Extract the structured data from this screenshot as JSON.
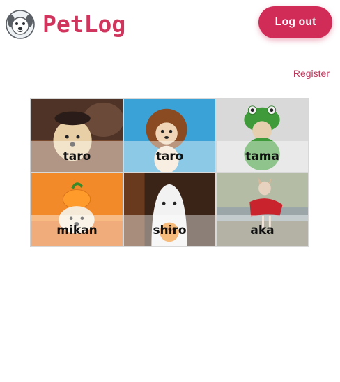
{
  "header": {
    "brand": "PetLog",
    "logo_icon": "dog-face-icon",
    "logout_label": "Log out"
  },
  "nav": {
    "register_label": "Register"
  },
  "pets": [
    {
      "name": "taro",
      "photo": "dog-in-pirate-costume",
      "bg": "#5a3a2a"
    },
    {
      "name": "taro",
      "photo": "chihuahua-in-lion-mane",
      "bg": "#3aa2d6"
    },
    {
      "name": "tama",
      "photo": "chihuahua-in-frog-hat",
      "bg": "#d8d8d8"
    },
    {
      "name": "mikan",
      "photo": "dog-with-pumpkin-hat",
      "bg": "#f28a2a"
    },
    {
      "name": "shiro",
      "photo": "dog-in-ghost-costume",
      "bg": "#3a2418"
    },
    {
      "name": "aka",
      "photo": "dog-in-red-cape",
      "bg": "#9aa6a8"
    }
  ],
  "colors": {
    "accent": "#d02c57",
    "brand_text": "#d0365d"
  }
}
